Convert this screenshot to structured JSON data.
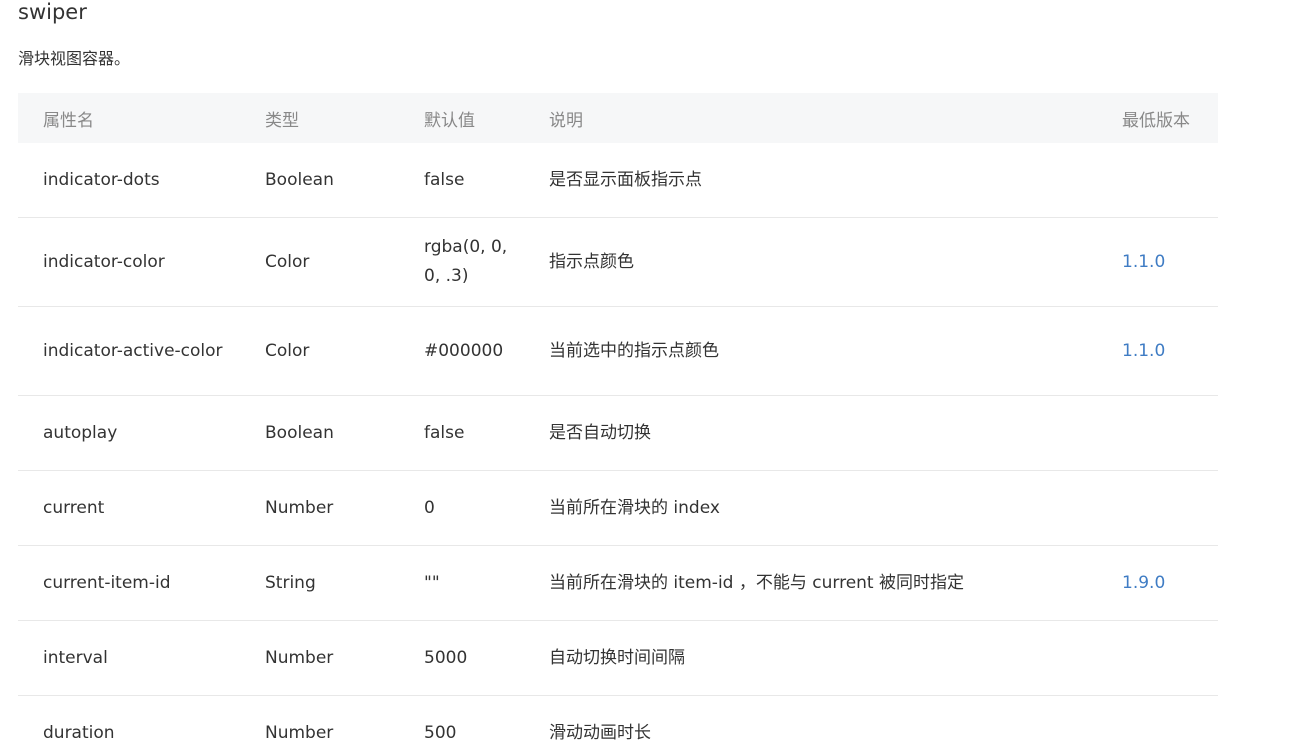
{
  "title": "swiper",
  "description": "滑块视图容器。",
  "table": {
    "headers": {
      "name": "属性名",
      "type": "类型",
      "default": "默认值",
      "desc": "说明",
      "version": "最低版本"
    },
    "rows": [
      {
        "name": "indicator-dots",
        "type": "Boolean",
        "default": "false",
        "desc": "是否显示面板指示点",
        "version": ""
      },
      {
        "name": "indicator-color",
        "type": "Color",
        "default": "rgba(0, 0, 0, .3)",
        "desc": "指示点颜色",
        "version": "1.1.0"
      },
      {
        "name": "indicator-active-color",
        "type": "Color",
        "default": "#000000",
        "desc": "当前选中的指示点颜色",
        "version": "1.1.0"
      },
      {
        "name": "autoplay",
        "type": "Boolean",
        "default": "false",
        "desc": "是否自动切换",
        "version": ""
      },
      {
        "name": "current",
        "type": "Number",
        "default": "0",
        "desc": "当前所在滑块的 index",
        "version": ""
      },
      {
        "name": "current-item-id",
        "type": "String",
        "default": "\"\"",
        "desc": "当前所在滑块的 item-id ，不能与 current 被同时指定",
        "version": "1.9.0"
      },
      {
        "name": "interval",
        "type": "Number",
        "default": "5000",
        "desc": "自动切换时间间隔",
        "version": ""
      },
      {
        "name": "duration",
        "type": "Number",
        "default": "500",
        "desc": "滑动动画时长",
        "version": ""
      }
    ]
  },
  "colors": {
    "header_bg": "#f6f7f8",
    "header_text": "#888888",
    "version_link": "#3f7cc4",
    "row_border": "#e8e8e8"
  }
}
